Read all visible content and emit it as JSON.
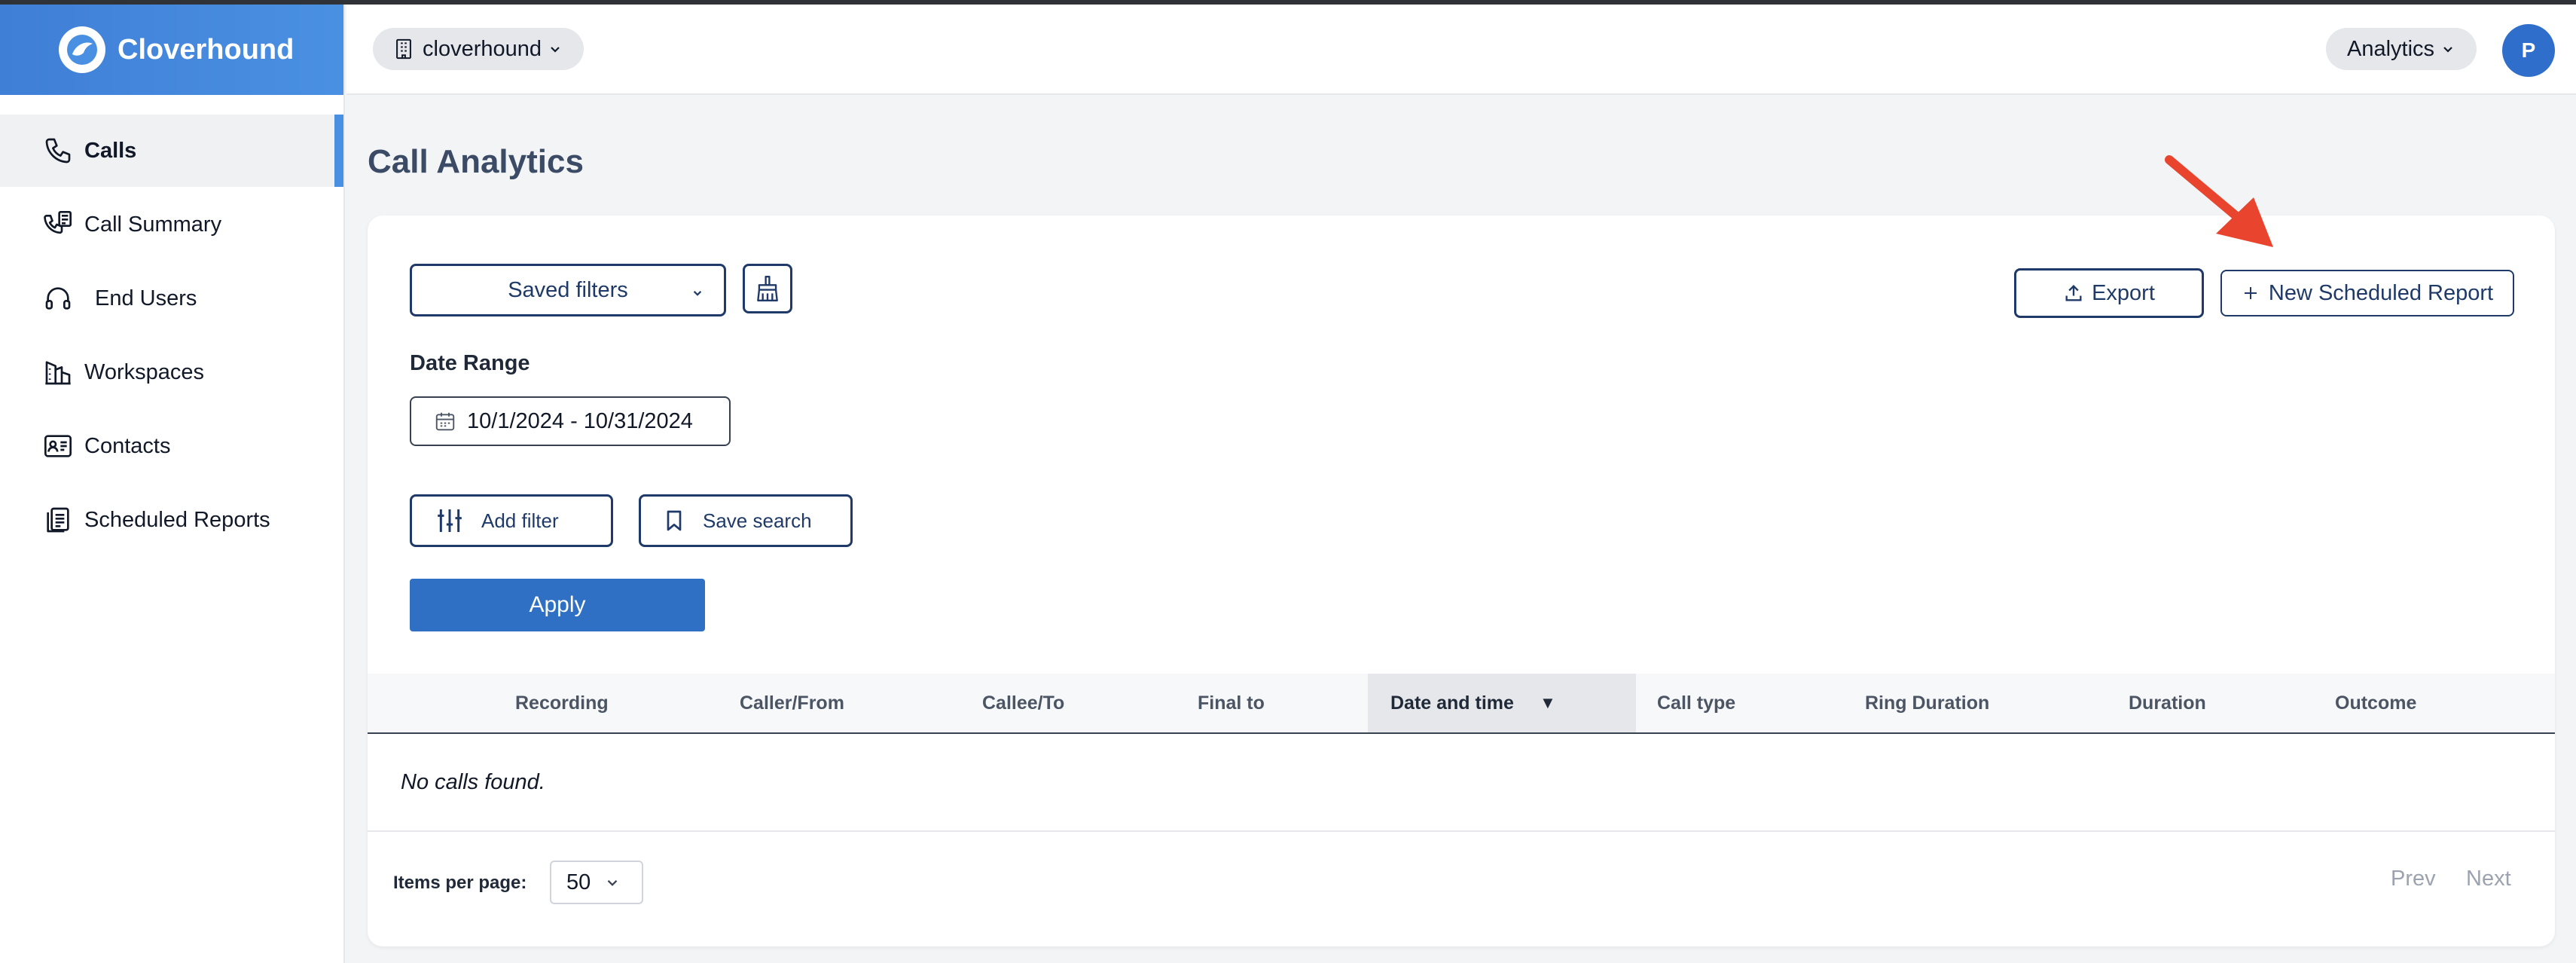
{
  "app": {
    "name": "Cloverhound"
  },
  "sidebar": {
    "items": [
      {
        "label": "Calls",
        "icon": "phone-icon",
        "active": true
      },
      {
        "label": "Call Summary",
        "icon": "call-summary-icon"
      },
      {
        "label": "End Users",
        "icon": "headset-icon"
      },
      {
        "label": "Workspaces",
        "icon": "building-icon"
      },
      {
        "label": "Contacts",
        "icon": "contact-card-icon"
      },
      {
        "label": "Scheduled Reports",
        "icon": "clipboard-icon"
      }
    ]
  },
  "topbar": {
    "org": "cloverhound",
    "section": "Analytics",
    "avatar_initial": "P"
  },
  "page": {
    "title": "Call Analytics"
  },
  "filters": {
    "saved_filters_label": "Saved filters",
    "export_label": "Export",
    "new_report_label": "New Scheduled Report",
    "date_range_label": "Date Range",
    "date_range_value": "10/1/2024 - 10/31/2024",
    "add_filter_label": "Add filter",
    "save_search_label": "Save search",
    "apply_label": "Apply"
  },
  "table": {
    "columns": [
      "Recording",
      "Caller/From",
      "Callee/To",
      "Final to",
      "Date and time",
      "Call type",
      "Ring Duration",
      "Duration",
      "Outcome"
    ],
    "sorted_column": "Date and time",
    "sort_indicator": "▼",
    "empty_message": "No calls found."
  },
  "pagination": {
    "items_per_page_label": "Items per page:",
    "items_per_page_value": "50",
    "prev_label": "Prev",
    "next_label": "Next"
  },
  "colors": {
    "brand": "#4a90e2",
    "primary_button": "#3070c4",
    "outline": "#1f3a68",
    "annotation_arrow": "#e8442e"
  }
}
